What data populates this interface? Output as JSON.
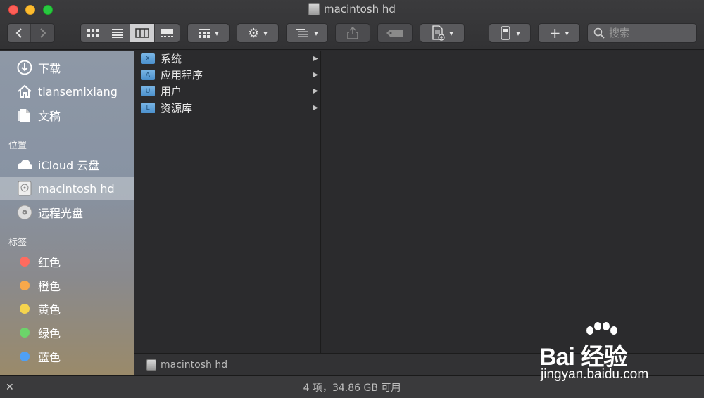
{
  "window": {
    "title": "macintosh hd"
  },
  "toolbar": {
    "search_placeholder": "搜索"
  },
  "sidebar": {
    "favorites": [
      {
        "label": "下载",
        "icon": "download-icon"
      },
      {
        "label": "tiansemixiang",
        "icon": "home-icon"
      },
      {
        "label": "文稿",
        "icon": "document-icon"
      }
    ],
    "locations_header": "位置",
    "locations": [
      {
        "label": "iCloud 云盘",
        "icon": "cloud-icon"
      },
      {
        "label": "macintosh hd",
        "icon": "hard-disk-icon",
        "selected": true
      },
      {
        "label": "远程光盘",
        "icon": "optical-disc-icon"
      }
    ],
    "tags_header": "标签",
    "tags": [
      {
        "label": "红色",
        "color": "#fe6b5f"
      },
      {
        "label": "橙色",
        "color": "#f7a84b"
      },
      {
        "label": "黄色",
        "color": "#f5d44d"
      },
      {
        "label": "绿色",
        "color": "#6cd46a"
      },
      {
        "label": "蓝色",
        "color": "#4fa0f5"
      }
    ]
  },
  "browser": {
    "column1": [
      {
        "label": "系统",
        "glyph": "X"
      },
      {
        "label": "应用程序",
        "glyph": "A"
      },
      {
        "label": "用户",
        "glyph": "U"
      },
      {
        "label": "资源库",
        "glyph": "L"
      }
    ]
  },
  "pathbar": {
    "label": "macintosh hd"
  },
  "statusbar": {
    "text": "4 项，34.86 GB 可用"
  },
  "watermark": {
    "logo": "Bai 经验",
    "site": "jingyan.baidu.com"
  }
}
